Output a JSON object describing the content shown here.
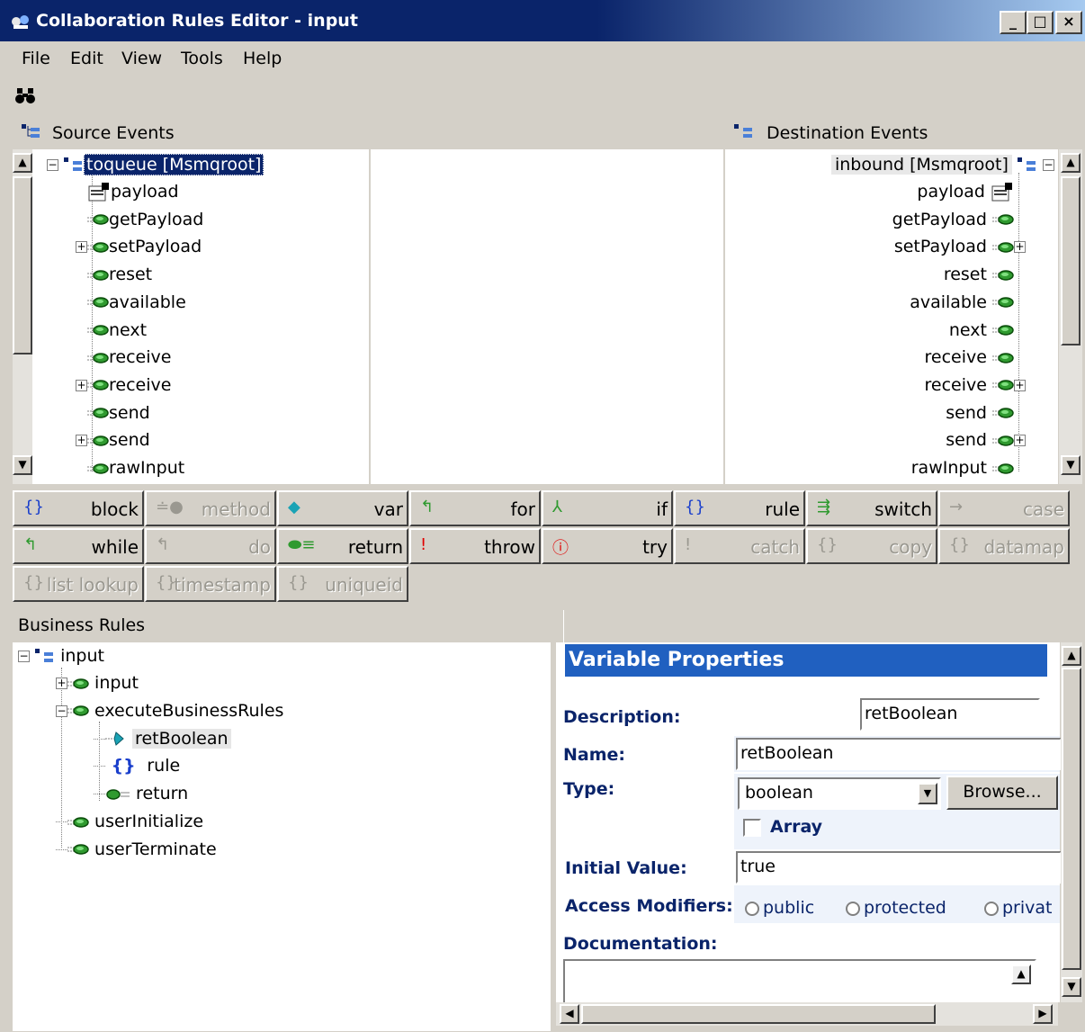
{
  "window": {
    "title": "Collaboration Rules Editor - input",
    "minimize": "_",
    "maximize": "□",
    "close": "×"
  },
  "menu": [
    "File",
    "Edit",
    "View",
    "Tools",
    "Help"
  ],
  "toolbar": {
    "find_icon": "binoculars-icon"
  },
  "source": {
    "header": "Source Events",
    "root": "toqueue [Msmqroot]",
    "items": [
      {
        "label": "payload",
        "icon": "property-icon",
        "expandable": false
      },
      {
        "label": "getPayload",
        "icon": "method-icon",
        "expandable": false
      },
      {
        "label": "setPayload",
        "icon": "method-icon",
        "expandable": true
      },
      {
        "label": "reset",
        "icon": "method-icon",
        "expandable": false
      },
      {
        "label": "available",
        "icon": "method-icon",
        "expandable": false
      },
      {
        "label": "next",
        "icon": "method-icon",
        "expandable": false
      },
      {
        "label": "receive",
        "icon": "method-icon",
        "expandable": false
      },
      {
        "label": "receive",
        "icon": "method-icon",
        "expandable": true
      },
      {
        "label": "send",
        "icon": "method-icon",
        "expandable": false
      },
      {
        "label": "send",
        "icon": "method-icon",
        "expandable": true
      },
      {
        "label": "rawInput",
        "icon": "method-icon",
        "expandable": false
      }
    ]
  },
  "destination": {
    "header": "Destination Events",
    "root": "inbound [Msmqroot]",
    "items": [
      {
        "label": "payload",
        "icon": "property-icon",
        "expandable": false
      },
      {
        "label": "getPayload",
        "icon": "method-icon",
        "expandable": false
      },
      {
        "label": "setPayload",
        "icon": "method-icon",
        "expandable": true
      },
      {
        "label": "reset",
        "icon": "method-icon",
        "expandable": false
      },
      {
        "label": "available",
        "icon": "method-icon",
        "expandable": false
      },
      {
        "label": "next",
        "icon": "method-icon",
        "expandable": false
      },
      {
        "label": "receive",
        "icon": "method-icon",
        "expandable": false
      },
      {
        "label": "receive",
        "icon": "method-icon",
        "expandable": true
      },
      {
        "label": "send",
        "icon": "method-icon",
        "expandable": false
      },
      {
        "label": "send",
        "icon": "method-icon",
        "expandable": true
      },
      {
        "label": "rawInput",
        "icon": "method-icon",
        "expandable": false
      }
    ]
  },
  "palette": [
    {
      "label": "block",
      "icon": "{}",
      "enabled": true
    },
    {
      "label": "method",
      "icon": "≐●",
      "enabled": false
    },
    {
      "label": "var",
      "icon": "◆",
      "enabled": true
    },
    {
      "label": "for",
      "icon": "↰",
      "enabled": true
    },
    {
      "label": "if",
      "icon": "⅄",
      "enabled": true
    },
    {
      "label": "rule",
      "icon": "{}",
      "enabled": true
    },
    {
      "label": "switch",
      "icon": "⇶",
      "enabled": true
    },
    {
      "label": "case",
      "icon": "→",
      "enabled": false
    },
    {
      "label": "while",
      "icon": "↰",
      "enabled": true
    },
    {
      "label": "do",
      "icon": "↰",
      "enabled": false
    },
    {
      "label": "return",
      "icon": "⬬≡",
      "enabled": true
    },
    {
      "label": "throw",
      "icon": "!",
      "enabled": true
    },
    {
      "label": "try",
      "icon": "ⓘ",
      "enabled": true
    },
    {
      "label": "catch",
      "icon": "!",
      "enabled": false
    },
    {
      "label": "copy",
      "icon": "{}",
      "enabled": false
    },
    {
      "label": "datamap",
      "icon": "{}",
      "enabled": false
    },
    {
      "label": "list lookup",
      "icon": "{}",
      "enabled": false
    },
    {
      "label": "timestamp",
      "icon": "{}",
      "enabled": false
    },
    {
      "label": "uniqueid",
      "icon": "{}",
      "enabled": false
    }
  ],
  "business_rules": {
    "header": "Business Rules",
    "root": "input",
    "nodes": [
      {
        "label": "input",
        "level": 1,
        "expand": "+"
      },
      {
        "label": "executeBusinessRules",
        "level": 1,
        "expand": "-"
      },
      {
        "label": "retBoolean",
        "level": 2,
        "expand": "",
        "selected": true
      },
      {
        "label": "rule",
        "level": 2,
        "expand": ""
      },
      {
        "label": "return",
        "level": 2,
        "expand": ""
      },
      {
        "label": "userInitialize",
        "level": 1,
        "expand": ""
      },
      {
        "label": "userTerminate",
        "level": 1,
        "expand": ""
      }
    ]
  },
  "properties": {
    "title": "Variable Properties",
    "description_label": "Description:",
    "description_value": "retBoolean",
    "name_label": "Name:",
    "name_value": "retBoolean",
    "type_label": "Type:",
    "type_value": "boolean",
    "browse_label": "Browse...",
    "array_label": "Array",
    "array_checked": false,
    "initial_label": "Initial Value:",
    "initial_value": "true",
    "access_label": "Access Modifiers:",
    "access_options": [
      "public",
      "protected",
      "privat"
    ],
    "doc_label": "Documentation:",
    "doc_value": ""
  },
  "colors": {
    "title_bar": "#0a246a",
    "selection": "#0a246a",
    "label_blue": "#0a246a",
    "method_green": "#2f9a2f",
    "face": "#d4d0c8"
  }
}
